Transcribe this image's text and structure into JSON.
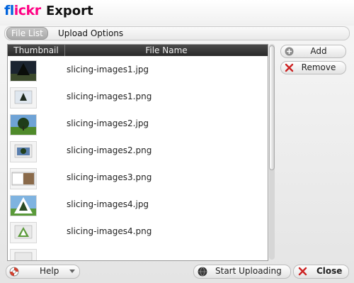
{
  "window": {
    "brand_fl": "fl",
    "brand_ickr": "ickr",
    "title": "Export"
  },
  "tabs": [
    {
      "label": "File List",
      "active": true
    },
    {
      "label": "Upload Options",
      "active": false
    }
  ],
  "list": {
    "columns": [
      "Thumbnail",
      "File Name"
    ],
    "rows": [
      {
        "file": "slicing-images1.jpg",
        "thumb": "dark-tree"
      },
      {
        "file": "slicing-images1.png",
        "thumb": "screenshot-tree"
      },
      {
        "file": "slicing-images2.jpg",
        "thumb": "tree-field"
      },
      {
        "file": "slicing-images2.png",
        "thumb": "screenshot-tree"
      },
      {
        "file": "slicing-images3.png",
        "thumb": "screenshot-photo"
      },
      {
        "file": "slicing-images4.jpg",
        "thumb": "triangle-tree"
      },
      {
        "file": "slicing-images4.png",
        "thumb": "screenshot-triangle"
      }
    ]
  },
  "side_buttons": {
    "add": "Add",
    "remove": "Remove"
  },
  "bottom": {
    "help": "Help",
    "start_uploading": "Start Uploading",
    "close": "Close"
  },
  "colors": {
    "flickr_blue": "#0063dc",
    "flickr_pink": "#ff0084",
    "remove_red": "#cc2222"
  }
}
